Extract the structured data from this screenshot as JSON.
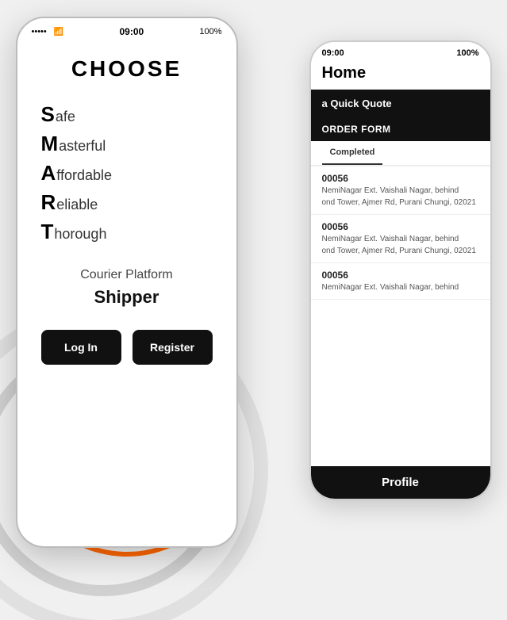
{
  "scene": {
    "background_color": "#f0f0f0"
  },
  "front_phone": {
    "status_bar": {
      "dots": "•••••",
      "signal": "▲",
      "wifi": "wifi",
      "time": "09:00",
      "battery": "100%"
    },
    "app_title": "CHOOSE",
    "smart_items": [
      {
        "letter": "S",
        "rest": "afe"
      },
      {
        "letter": "M",
        "rest": "asterful"
      },
      {
        "letter": "A",
        "rest": "ffordable"
      },
      {
        "letter": "R",
        "rest": "eliable"
      },
      {
        "letter": "T",
        "rest": "horough"
      }
    ],
    "courier_platform": "Courier Platform",
    "shipper": "Shipper",
    "login_label": "Log In",
    "register_label": "Register"
  },
  "back_phone": {
    "status_bar": {
      "time": "09:00",
      "battery": "100%"
    },
    "header": "Home",
    "quick_quote_label": "a Quick Quote",
    "order_form_label": "ORDER FORM",
    "tabs": [
      {
        "label": "Completed",
        "active": true
      }
    ],
    "orders": [
      {
        "id": "00056",
        "from": "NemiNagar Ext. Vaishali Nagar, behind",
        "to": "ond Tower, Ajmer Rd, Purani Chungi, 02021"
      },
      {
        "id": "00056",
        "from": "NemiNagar Ext. Vaishali Nagar, behind",
        "to": "ond Tower, Ajmer Rd, Purani Chungi, 02021"
      },
      {
        "id": "00056",
        "from": "NemiNagar Ext. Vaishali Nagar, behind",
        "to": ""
      }
    ],
    "footer_label": "Profile"
  }
}
